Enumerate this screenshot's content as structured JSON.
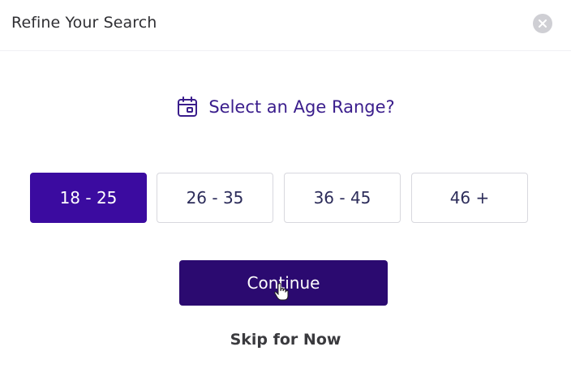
{
  "header": {
    "title": "Refine Your Search",
    "close_icon": "close-icon"
  },
  "prompt": {
    "icon": "calendar-icon",
    "text": "Select an Age Range?"
  },
  "age_ranges": [
    {
      "label": "18 - 25",
      "selected": true
    },
    {
      "label": "26 - 35",
      "selected": false
    },
    {
      "label": "36 - 45",
      "selected": false
    },
    {
      "label": "46 +",
      "selected": false
    }
  ],
  "actions": {
    "continue_label": "Continue",
    "skip_label": "Skip for Now"
  },
  "colors": {
    "accent": "#3b0ba0",
    "continue_bg": "#2b0a70",
    "prompt_text": "#3a1d8c"
  }
}
